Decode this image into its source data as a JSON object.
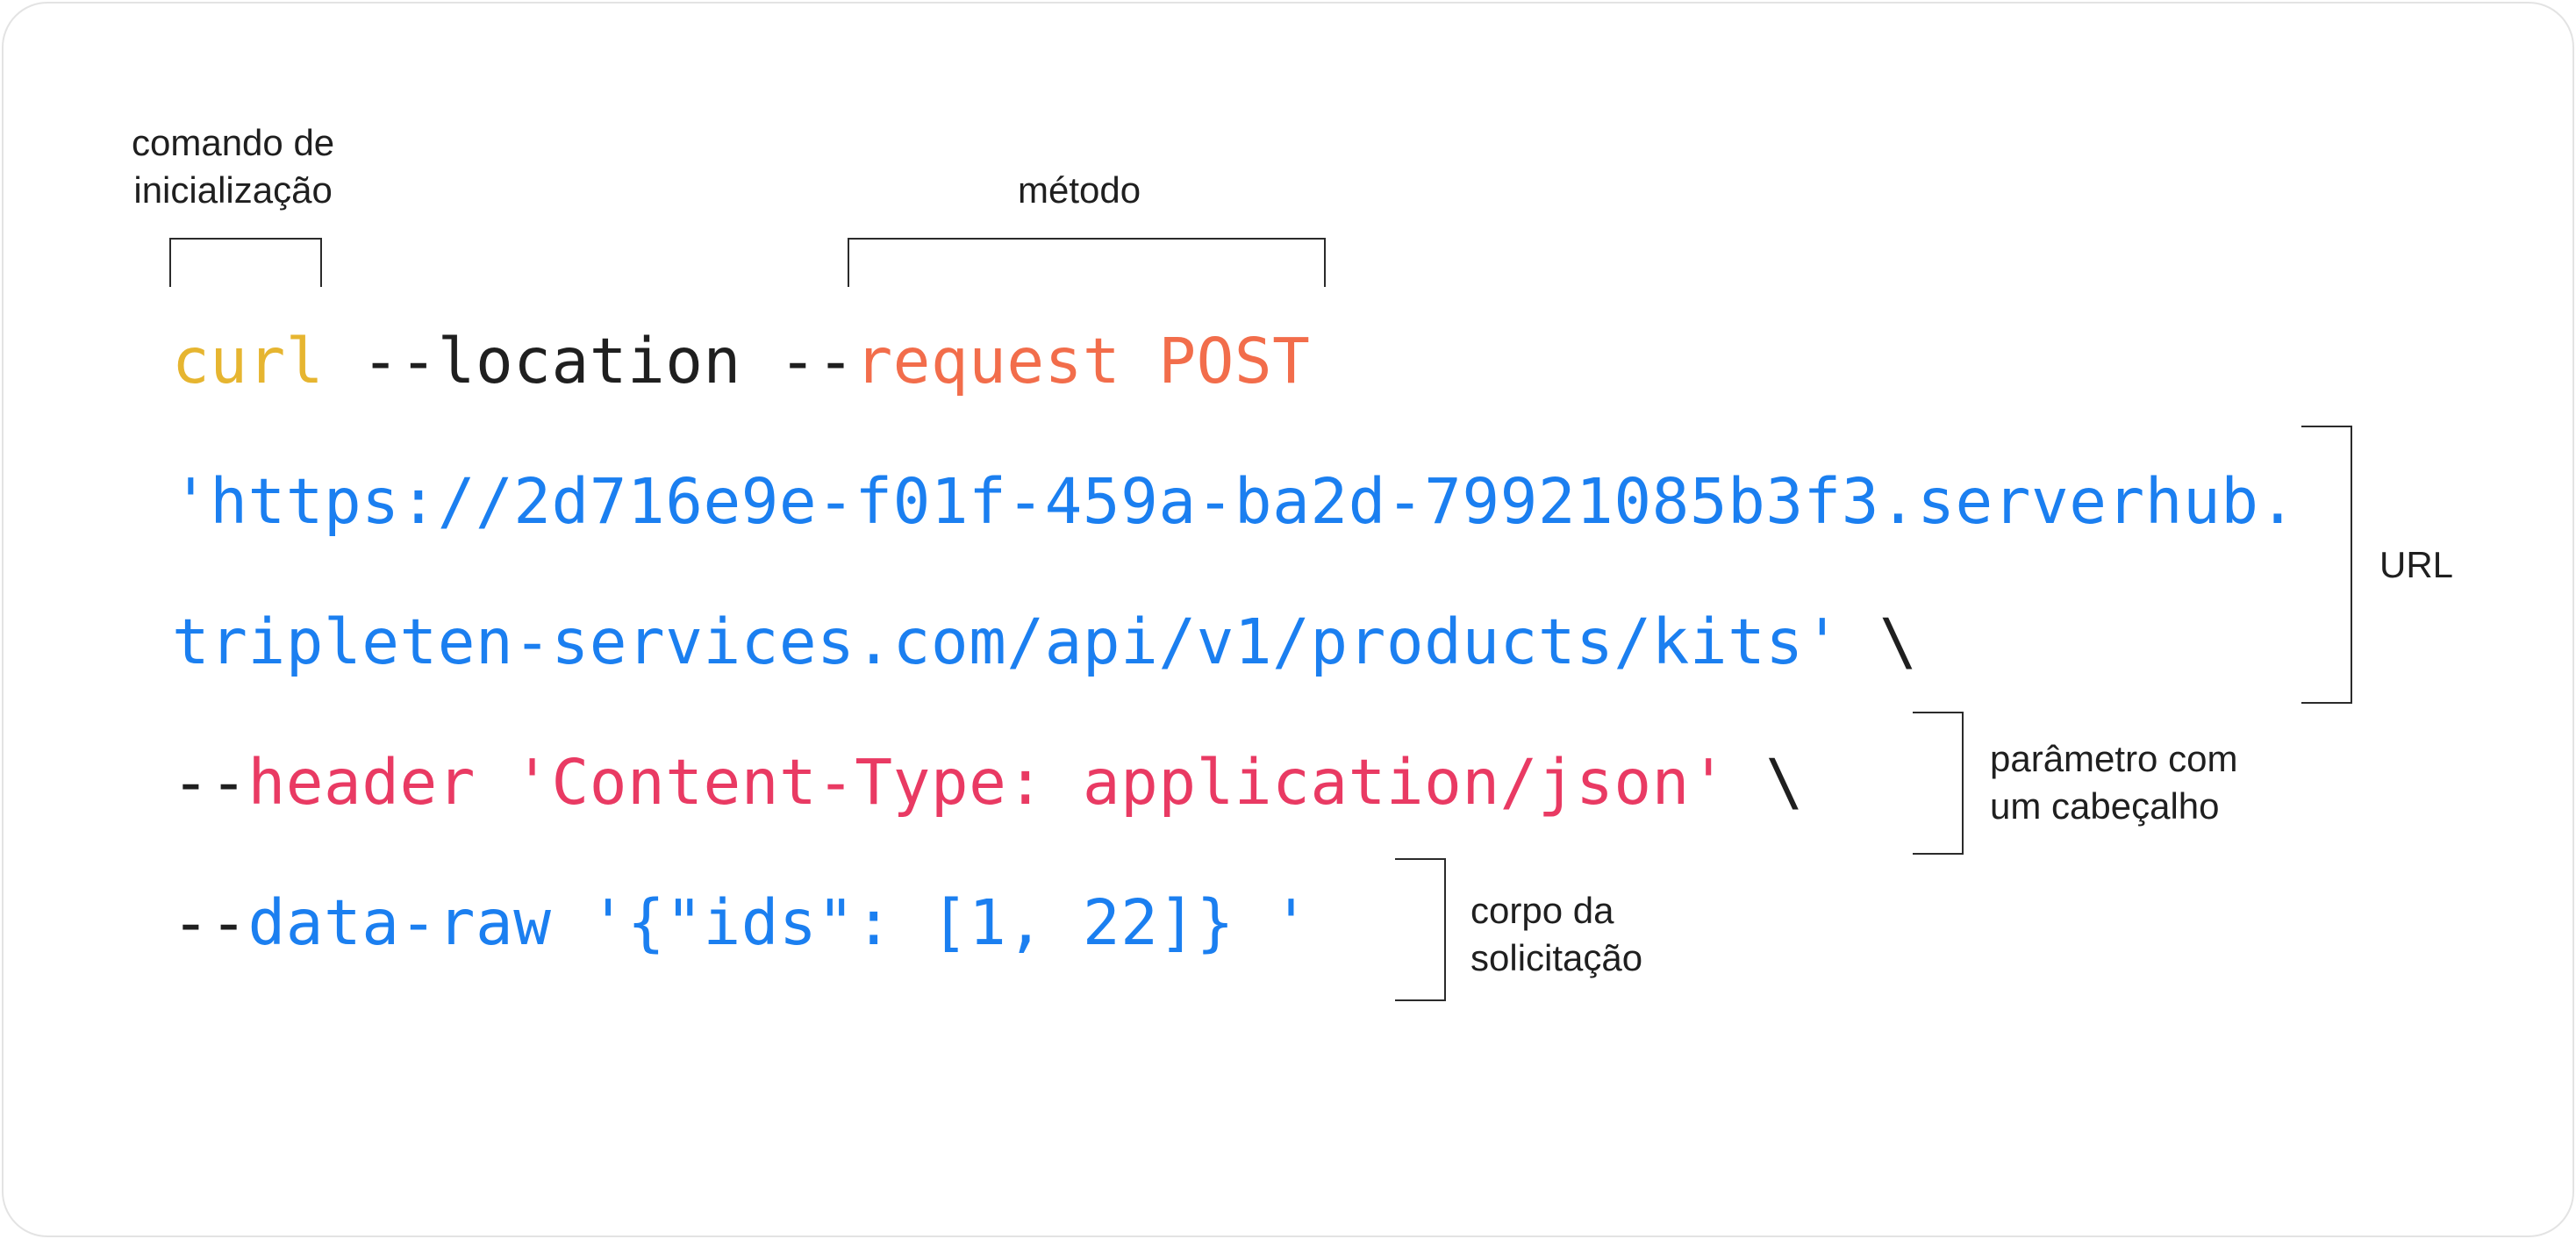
{
  "colors": {
    "command": "#e6b530",
    "method": "#f26d4b",
    "url": "#1b7ff0",
    "header": "#e93a63",
    "data": "#1b7ff0",
    "plain": "#1f1f1f"
  },
  "code": {
    "line1": {
      "command": "curl",
      "location_flag": " --location --",
      "request": "request POST"
    },
    "line2": {
      "url_part1": "'https://2d716e9e-f01f-459a-ba2d-79921085b3f3.serverhub."
    },
    "line3": {
      "url_part2": "tripleten-services.com/api/v1/products/kits'",
      "continuation": " \\"
    },
    "line4": {
      "dashes": "--",
      "header": "header 'Content-Type: application/json'",
      "continuation": " \\"
    },
    "line5": {
      "dashes": "--",
      "data": "data-raw '{\"ids\": [1, 22]} '"
    }
  },
  "annotations": {
    "command": [
      "comando de",
      "inicialização"
    ],
    "method": "método",
    "url": "URL",
    "header_param": [
      "parâmetro com",
      "um cabeçalho"
    ],
    "request_body": [
      "corpo da",
      "solicitação"
    ]
  }
}
